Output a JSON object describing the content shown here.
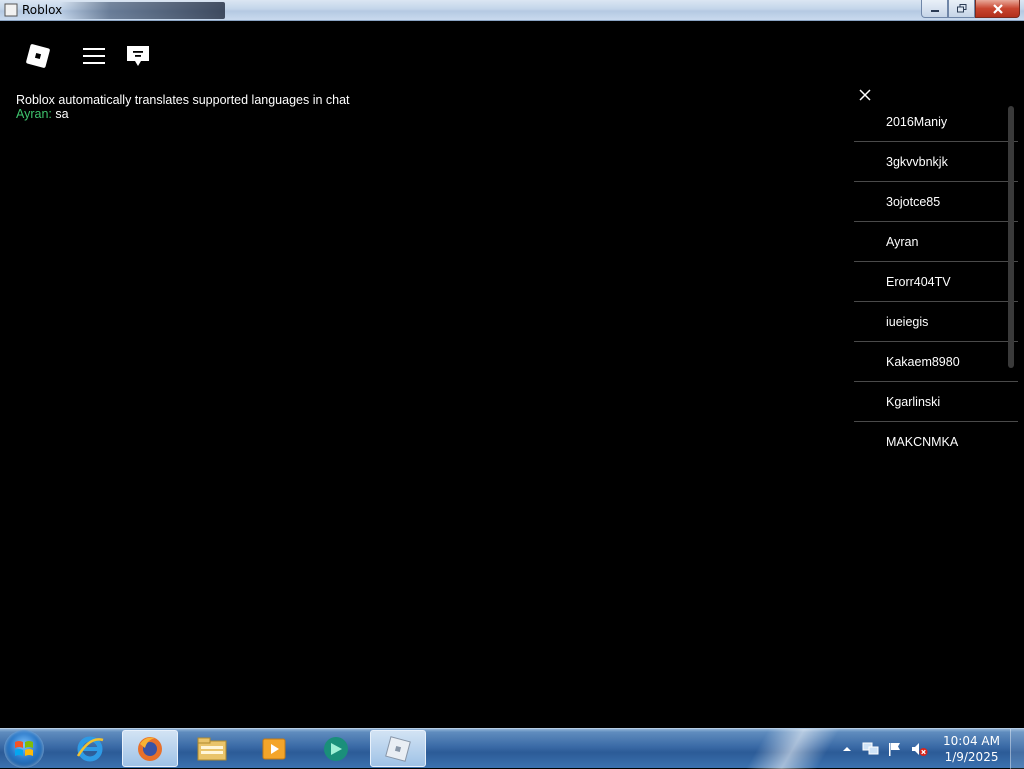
{
  "window": {
    "title": "Roblox"
  },
  "topbar": {
    "icons": [
      "roblox-logo-icon",
      "hamburger-menu-icon",
      "chat-icon"
    ]
  },
  "chat": {
    "system_message": "Roblox automatically translates supported languages in chat",
    "messages": [
      {
        "speaker": "Ayran:",
        "text": " sa"
      }
    ],
    "speaker_color": "#3ec46d"
  },
  "player_list": {
    "players": [
      "2016Maniy",
      "3gkvvbnkjk",
      "3ojotce85",
      "Ayran",
      "Erorr404TV",
      "iueiegis",
      "Kakaem8980",
      "Kgarlinski",
      "MAKCNMKA"
    ]
  },
  "taskbar": {
    "pinned": [
      "start-orb-icon",
      "internet-explorer-icon",
      "firefox-icon",
      "file-explorer-icon",
      "media-player-icon",
      "app-icon",
      "roblox-taskbar-icon"
    ],
    "clock_time": "10:04 AM",
    "clock_date": "1/9/2025"
  }
}
